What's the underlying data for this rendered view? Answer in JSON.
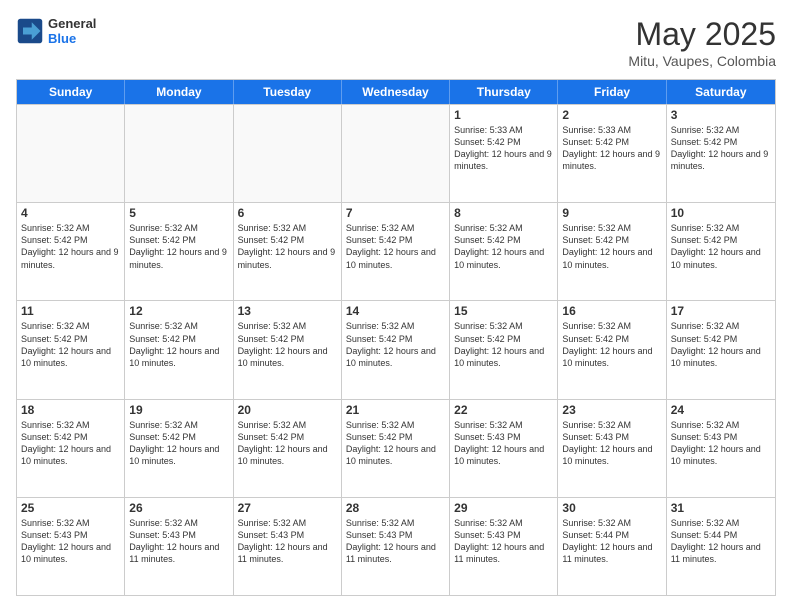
{
  "header": {
    "logo_general": "General",
    "logo_blue": "Blue",
    "month_title": "May 2025",
    "location": "Mitu, Vaupes, Colombia"
  },
  "calendar": {
    "days_of_week": [
      "Sunday",
      "Monday",
      "Tuesday",
      "Wednesday",
      "Thursday",
      "Friday",
      "Saturday"
    ],
    "weeks": [
      [
        {
          "day": "",
          "empty": true
        },
        {
          "day": "",
          "empty": true
        },
        {
          "day": "",
          "empty": true
        },
        {
          "day": "",
          "empty": true
        },
        {
          "day": "1",
          "sunrise": "5:33 AM",
          "sunset": "5:42 PM",
          "daylight": "12 hours and 9 minutes."
        },
        {
          "day": "2",
          "sunrise": "5:33 AM",
          "sunset": "5:42 PM",
          "daylight": "12 hours and 9 minutes."
        },
        {
          "day": "3",
          "sunrise": "5:32 AM",
          "sunset": "5:42 PM",
          "daylight": "12 hours and 9 minutes."
        }
      ],
      [
        {
          "day": "4",
          "sunrise": "5:32 AM",
          "sunset": "5:42 PM",
          "daylight": "12 hours and 9 minutes."
        },
        {
          "day": "5",
          "sunrise": "5:32 AM",
          "sunset": "5:42 PM",
          "daylight": "12 hours and 9 minutes."
        },
        {
          "day": "6",
          "sunrise": "5:32 AM",
          "sunset": "5:42 PM",
          "daylight": "12 hours and 9 minutes."
        },
        {
          "day": "7",
          "sunrise": "5:32 AM",
          "sunset": "5:42 PM",
          "daylight": "12 hours and 10 minutes."
        },
        {
          "day": "8",
          "sunrise": "5:32 AM",
          "sunset": "5:42 PM",
          "daylight": "12 hours and 10 minutes."
        },
        {
          "day": "9",
          "sunrise": "5:32 AM",
          "sunset": "5:42 PM",
          "daylight": "12 hours and 10 minutes."
        },
        {
          "day": "10",
          "sunrise": "5:32 AM",
          "sunset": "5:42 PM",
          "daylight": "12 hours and 10 minutes."
        }
      ],
      [
        {
          "day": "11",
          "sunrise": "5:32 AM",
          "sunset": "5:42 PM",
          "daylight": "12 hours and 10 minutes."
        },
        {
          "day": "12",
          "sunrise": "5:32 AM",
          "sunset": "5:42 PM",
          "daylight": "12 hours and 10 minutes."
        },
        {
          "day": "13",
          "sunrise": "5:32 AM",
          "sunset": "5:42 PM",
          "daylight": "12 hours and 10 minutes."
        },
        {
          "day": "14",
          "sunrise": "5:32 AM",
          "sunset": "5:42 PM",
          "daylight": "12 hours and 10 minutes."
        },
        {
          "day": "15",
          "sunrise": "5:32 AM",
          "sunset": "5:42 PM",
          "daylight": "12 hours and 10 minutes."
        },
        {
          "day": "16",
          "sunrise": "5:32 AM",
          "sunset": "5:42 PM",
          "daylight": "12 hours and 10 minutes."
        },
        {
          "day": "17",
          "sunrise": "5:32 AM",
          "sunset": "5:42 PM",
          "daylight": "12 hours and 10 minutes."
        }
      ],
      [
        {
          "day": "18",
          "sunrise": "5:32 AM",
          "sunset": "5:42 PM",
          "daylight": "12 hours and 10 minutes."
        },
        {
          "day": "19",
          "sunrise": "5:32 AM",
          "sunset": "5:42 PM",
          "daylight": "12 hours and 10 minutes."
        },
        {
          "day": "20",
          "sunrise": "5:32 AM",
          "sunset": "5:42 PM",
          "daylight": "12 hours and 10 minutes."
        },
        {
          "day": "21",
          "sunrise": "5:32 AM",
          "sunset": "5:42 PM",
          "daylight": "12 hours and 10 minutes."
        },
        {
          "day": "22",
          "sunrise": "5:32 AM",
          "sunset": "5:43 PM",
          "daylight": "12 hours and 10 minutes."
        },
        {
          "day": "23",
          "sunrise": "5:32 AM",
          "sunset": "5:43 PM",
          "daylight": "12 hours and 10 minutes."
        },
        {
          "day": "24",
          "sunrise": "5:32 AM",
          "sunset": "5:43 PM",
          "daylight": "12 hours and 10 minutes."
        }
      ],
      [
        {
          "day": "25",
          "sunrise": "5:32 AM",
          "sunset": "5:43 PM",
          "daylight": "12 hours and 10 minutes."
        },
        {
          "day": "26",
          "sunrise": "5:32 AM",
          "sunset": "5:43 PM",
          "daylight": "12 hours and 11 minutes."
        },
        {
          "day": "27",
          "sunrise": "5:32 AM",
          "sunset": "5:43 PM",
          "daylight": "12 hours and 11 minutes."
        },
        {
          "day": "28",
          "sunrise": "5:32 AM",
          "sunset": "5:43 PM",
          "daylight": "12 hours and 11 minutes."
        },
        {
          "day": "29",
          "sunrise": "5:32 AM",
          "sunset": "5:43 PM",
          "daylight": "12 hours and 11 minutes."
        },
        {
          "day": "30",
          "sunrise": "5:32 AM",
          "sunset": "5:44 PM",
          "daylight": "12 hours and 11 minutes."
        },
        {
          "day": "31",
          "sunrise": "5:32 AM",
          "sunset": "5:44 PM",
          "daylight": "12 hours and 11 minutes."
        }
      ]
    ]
  }
}
